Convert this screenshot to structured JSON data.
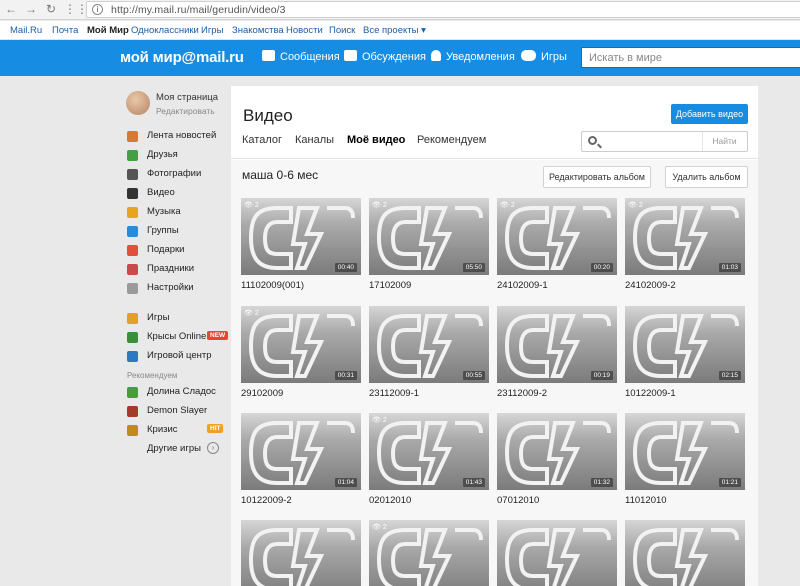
{
  "browser": {
    "url": "http://my.mail.ru/mail/gerudin/video/3"
  },
  "portal": {
    "links": [
      "Mail.Ru",
      "Почта",
      "Мой Мир",
      "Одноклассники",
      "Игры",
      "Знакомства",
      "Новости",
      "Поиск",
      "Все проекты ▾"
    ],
    "active": "Мой Мир"
  },
  "header": {
    "logo": "мой мир@mail.ru",
    "nav": [
      "Сообщения",
      "Обсуждения",
      "Уведомления",
      "Игры"
    ],
    "search_placeholder": "Искать в мире",
    "accent": "#168de2"
  },
  "sidebar": {
    "profile_name": "Моя страница",
    "profile_edit": "Редактировать",
    "items": [
      {
        "label": "Лента новостей",
        "icon": "home-icon",
        "color": "#d9782f"
      },
      {
        "label": "Друзья",
        "icon": "friends-icon",
        "color": "#45a045"
      },
      {
        "label": "Фотографии",
        "icon": "camera-icon",
        "color": "#555555"
      },
      {
        "label": "Видео",
        "icon": "video-icon",
        "color": "#333333"
      },
      {
        "label": "Музыка",
        "icon": "music-icon",
        "color": "#e8a41c"
      },
      {
        "label": "Группы",
        "icon": "groups-icon",
        "color": "#2a8ad6"
      },
      {
        "label": "Подарки",
        "icon": "gift-icon",
        "color": "#e0503b"
      },
      {
        "label": "Праздники",
        "icon": "calendar-icon",
        "color": "#c94a4a"
      },
      {
        "label": "Настройки",
        "icon": "gear-icon",
        "color": "#9a9a9a"
      }
    ],
    "games": [
      {
        "label": "Игры",
        "icon": "games-icon",
        "color": "#e1a02a"
      },
      {
        "label": "Крысы Online",
        "icon": "rat-game-icon",
        "color": "#3b8f3b",
        "badge": "NEW",
        "badge_color": "#e8452f"
      },
      {
        "label": "Игровой центр",
        "icon": "game-center-icon",
        "color": "#2b79c2"
      }
    ],
    "recommended_label": "Рекомендуем",
    "recommended": [
      {
        "label": "Долина Сладос",
        "icon": "candy-valley-icon",
        "color": "#4a9c3a"
      },
      {
        "label": "Demon Slayer",
        "icon": "demon-slayer-icon",
        "color": "#a33a2a"
      },
      {
        "label": "Кризис",
        "icon": "crisis-icon",
        "color": "#c28a1e",
        "badge": "HIT",
        "badge_color": "#f0a02a"
      }
    ],
    "more_games": "Другие игры"
  },
  "main": {
    "title": "Видео",
    "add_video": "Добавить видео",
    "tabs": [
      "Каталог",
      "Каналы",
      "Моё видео",
      "Рекомендуем"
    ],
    "active_tab": "Моё видео",
    "search_button": "Найти",
    "album_title": "маша 0-6 мес",
    "edit_album": "Редактировать альбом",
    "delete_album": "Удалить альбом",
    "videos": [
      {
        "title": "11102009(001)",
        "duration": "00:40",
        "views": "2"
      },
      {
        "title": "17102009",
        "duration": "05:50",
        "views": "2"
      },
      {
        "title": "24102009-1",
        "duration": "00:20",
        "views": "2"
      },
      {
        "title": "24102009-2",
        "duration": "01:03",
        "views": "2"
      },
      {
        "title": "29102009",
        "duration": "00:31",
        "views": "2"
      },
      {
        "title": "23112009-1",
        "duration": "00:55",
        "views": ""
      },
      {
        "title": "23112009-2",
        "duration": "00:19",
        "views": ""
      },
      {
        "title": "10122009-1",
        "duration": "02:15",
        "views": ""
      },
      {
        "title": "10122009-2",
        "duration": "01:04",
        "views": ""
      },
      {
        "title": "02012010",
        "duration": "01:43",
        "views": "2"
      },
      {
        "title": "07012010",
        "duration": "01:32",
        "views": ""
      },
      {
        "title": "11012010",
        "duration": "01:21",
        "views": ""
      },
      {
        "title": "",
        "duration": "",
        "views": ""
      },
      {
        "title": "",
        "duration": "",
        "views": "2"
      },
      {
        "title": "",
        "duration": "",
        "views": ""
      },
      {
        "title": "",
        "duration": "",
        "views": ""
      }
    ]
  }
}
